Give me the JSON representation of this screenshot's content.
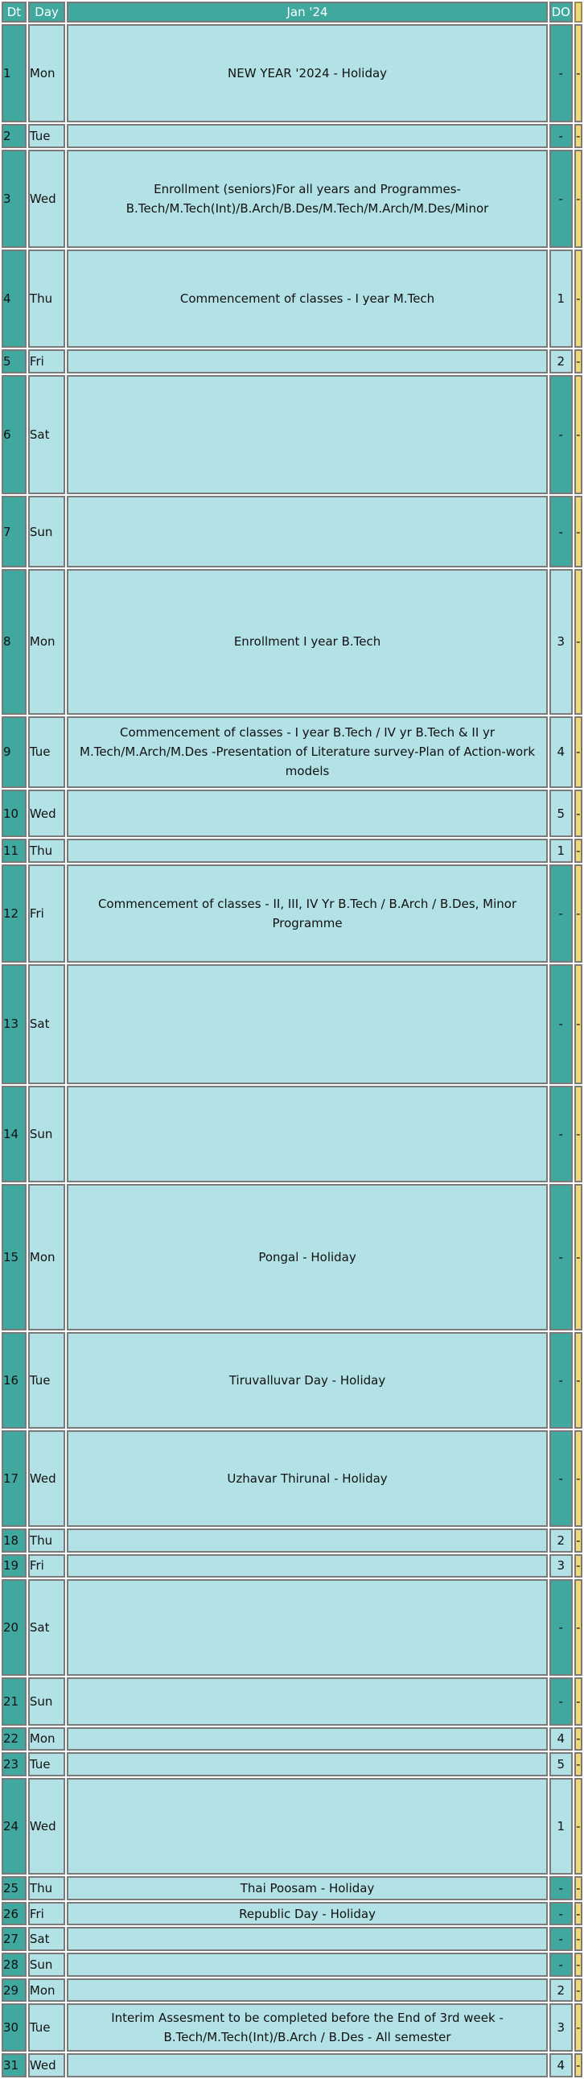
{
  "header": {
    "dt": "Dt",
    "day": "Day",
    "month": "Jan '24",
    "do": "DO",
    "extra": ""
  },
  "colors": {
    "header_bg": "#3fa99e",
    "row_bg": "#b2e1e6",
    "event_text": "#2222cc",
    "extra_col": "#f0d87a"
  },
  "rows": [
    {
      "dt": "1",
      "day": "Mon",
      "event": "NEW YEAR '2024 - Holiday",
      "do": "-",
      "x": "-",
      "holiday": true
    },
    {
      "dt": "2",
      "day": "Tue",
      "event": "",
      "do": "-",
      "x": "-",
      "holiday": true
    },
    {
      "dt": "3",
      "day": "Wed",
      "event": "Enrollment (seniors)For all years and Programmes- B.Tech/M.Tech(Int)/B.Arch/B.Des/M.Tech/M.Arch/M.Des/Minor",
      "do": "-",
      "x": "-",
      "holiday": true
    },
    {
      "dt": "4",
      "day": "Thu",
      "event": "Commencement of classes - I year M.Tech",
      "do": "1",
      "x": "-",
      "holiday": false
    },
    {
      "dt": "5",
      "day": "Fri",
      "event": "",
      "do": "2",
      "x": "-",
      "holiday": false
    },
    {
      "dt": "6",
      "day": "Sat",
      "event": "",
      "do": "-",
      "x": "-",
      "holiday": true
    },
    {
      "dt": "7",
      "day": "Sun",
      "event": "",
      "do": "-",
      "x": "-",
      "holiday": true
    },
    {
      "dt": "8",
      "day": "Mon",
      "event": "Enrollment I year B.Tech",
      "do": "3",
      "x": "-",
      "holiday": false
    },
    {
      "dt": "9",
      "day": "Tue",
      "event": "Commencement of classes - I year B.Tech / IV yr B.Tech & II yr M.Tech/M.Arch/M.Des -Presentation of Literature survey-Plan of Action-work models",
      "do": "4",
      "x": "-",
      "holiday": false
    },
    {
      "dt": "10",
      "day": "Wed",
      "event": "",
      "do": "5",
      "x": "-",
      "holiday": false
    },
    {
      "dt": "11",
      "day": "Thu",
      "event": "",
      "do": "1",
      "x": "-",
      "holiday": false
    },
    {
      "dt": "12",
      "day": "Fri",
      "event": "Commencement of classes - II, III, IV Yr B.Tech / B.Arch / B.Des, Minor Programme",
      "do": "-",
      "x": "-",
      "holiday": true
    },
    {
      "dt": "13",
      "day": "Sat",
      "event": "",
      "do": "-",
      "x": "-",
      "holiday": true
    },
    {
      "dt": "14",
      "day": "Sun",
      "event": "",
      "do": "-",
      "x": "-",
      "holiday": true
    },
    {
      "dt": "15",
      "day": "Mon",
      "event": "Pongal - Holiday",
      "do": "-",
      "x": "-",
      "holiday": true
    },
    {
      "dt": "16",
      "day": "Tue",
      "event": "Tiruvalluvar Day - Holiday",
      "do": "-",
      "x": "-",
      "holiday": true
    },
    {
      "dt": "17",
      "day": "Wed",
      "event": "Uzhavar Thirunal - Holiday",
      "do": "-",
      "x": "-",
      "holiday": true
    },
    {
      "dt": "18",
      "day": "Thu",
      "event": "",
      "do": "2",
      "x": "-",
      "holiday": false
    },
    {
      "dt": "19",
      "day": "Fri",
      "event": "",
      "do": "3",
      "x": "-",
      "holiday": false
    },
    {
      "dt": "20",
      "day": "Sat",
      "event": "",
      "do": "-",
      "x": "-",
      "holiday": true
    },
    {
      "dt": "21",
      "day": "Sun",
      "event": "",
      "do": "-",
      "x": "-",
      "holiday": true
    },
    {
      "dt": "22",
      "day": "Mon",
      "event": "",
      "do": "4",
      "x": "-",
      "holiday": false
    },
    {
      "dt": "23",
      "day": "Tue",
      "event": "",
      "do": "5",
      "x": "-",
      "holiday": false
    },
    {
      "dt": "24",
      "day": "Wed",
      "event": "",
      "do": "1",
      "x": "-",
      "holiday": false
    },
    {
      "dt": "25",
      "day": "Thu",
      "event": "Thai Poosam - Holiday",
      "do": "-",
      "x": "-",
      "holiday": true
    },
    {
      "dt": "26",
      "day": "Fri",
      "event": "Republic Day - Holiday",
      "do": "-",
      "x": "-",
      "holiday": true
    },
    {
      "dt": "27",
      "day": "Sat",
      "event": "",
      "do": "-",
      "x": "-",
      "holiday": true
    },
    {
      "dt": "28",
      "day": "Sun",
      "event": "",
      "do": "-",
      "x": "-",
      "holiday": true
    },
    {
      "dt": "29",
      "day": "Mon",
      "event": "",
      "do": "2",
      "x": "-",
      "holiday": false
    },
    {
      "dt": "30",
      "day": "Tue",
      "event": "Interim Assesment to be completed before the End of 3rd week - B.Tech/M.Tech(Int)/B.Arch / B.Des - All semester",
      "do": "3",
      "x": "-",
      "holiday": false
    },
    {
      "dt": "31",
      "day": "Wed",
      "event": "",
      "do": "4",
      "x": "-",
      "holiday": false
    }
  ]
}
